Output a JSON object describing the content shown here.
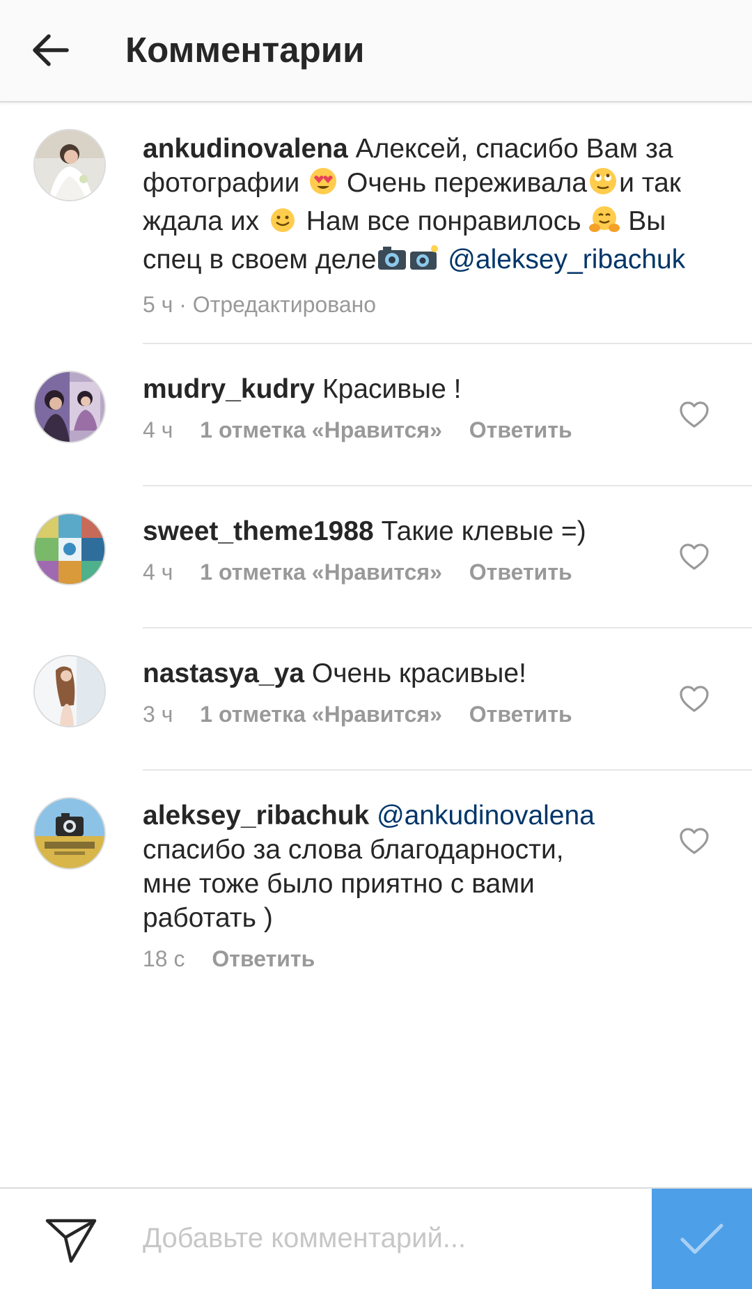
{
  "header": {
    "title": "Комментарии"
  },
  "comments": [
    {
      "username": "ankudinovalena",
      "segments": [
        "Алексей, спасибо Вам за фотографии",
        "Очень переживала",
        "и так ждала их",
        "Нам все понравилось",
        "Вы спец в своем деле"
      ],
      "mention": "@aleksey_ribachuk",
      "time": "5 ч",
      "edited": "· Отредактировано"
    },
    {
      "username": "mudry_kudry",
      "text": "Красивые !",
      "time": "4 ч",
      "likes": "1 отметка «Нравится»",
      "reply": "Ответить"
    },
    {
      "username": "sweet_theme1988",
      "text": "Такие клевые =)",
      "time": "4 ч",
      "likes": "1 отметка «Нравится»",
      "reply": "Ответить"
    },
    {
      "username": "nastasya_ya",
      "text": "Очень красивые!",
      "time": "3 ч",
      "likes": "1 отметка «Нравится»",
      "reply": "Ответить"
    },
    {
      "username": "aleksey_ribachuk",
      "mention": "@ankudinovalena",
      "text": "спасибо за слова благодарности, мне тоже было приятно с вами работать )",
      "time": "18 с",
      "reply": "Ответить"
    }
  ],
  "composer": {
    "placeholder": "Добавьте комментарий..."
  },
  "icons": {
    "back": "arrow-left-icon",
    "heart": "heart-outline-icon",
    "send": "paper-plane-icon",
    "post": "checkmark-icon"
  },
  "colors": {
    "mention": "#003569",
    "meta": "#999999",
    "post_button": "#4d9fe8"
  }
}
